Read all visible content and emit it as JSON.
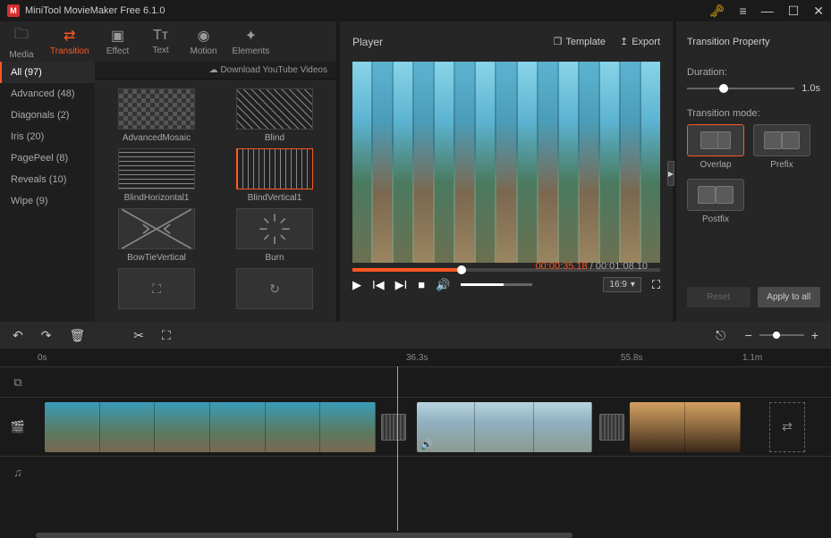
{
  "app": {
    "title": "MiniTool MovieMaker Free 6.1.0"
  },
  "mediaTabs": [
    {
      "label": "Media",
      "icon": "🗀"
    },
    {
      "label": "Transition",
      "icon": "⇄"
    },
    {
      "label": "Effect",
      "icon": "▣"
    },
    {
      "label": "Text",
      "icon": "Tт"
    },
    {
      "label": "Motion",
      "icon": "◉"
    },
    {
      "label": "Elements",
      "icon": "✦"
    }
  ],
  "categories": [
    {
      "label": "All (97)",
      "active": true
    },
    {
      "label": "Advanced (48)"
    },
    {
      "label": "Diagonals (2)"
    },
    {
      "label": "Iris (20)"
    },
    {
      "label": "PagePeel (8)"
    },
    {
      "label": "Reveals (10)"
    },
    {
      "label": "Wipe (9)"
    }
  ],
  "downloadLink": "Download YouTube Videos",
  "transitions": [
    {
      "label": "AdvancedMosaic"
    },
    {
      "label": "Blind"
    },
    {
      "label": "BlindHorizontal1"
    },
    {
      "label": "BlindVertical1",
      "selected": true
    },
    {
      "label": "BowTieVertical"
    },
    {
      "label": "Burn"
    }
  ],
  "player": {
    "title": "Player",
    "templateBtn": "Template",
    "exportBtn": "Export",
    "currentTime": "00:00:35.18",
    "totalTime": "00:01:08.10",
    "aspect": "16:9"
  },
  "props": {
    "title": "Transition Property",
    "durationLabel": "Duration:",
    "durationValue": "1.0s",
    "modeLabel": "Transition mode:",
    "modes": [
      {
        "label": "Overlap",
        "selected": true
      },
      {
        "label": "Prefix"
      },
      {
        "label": "Postfix"
      }
    ],
    "resetBtn": "Reset",
    "applyBtn": "Apply to all"
  },
  "ruler": {
    "t0": "0s",
    "t1": "36.3s",
    "t2": "55.8s",
    "t3": "1.1m"
  }
}
